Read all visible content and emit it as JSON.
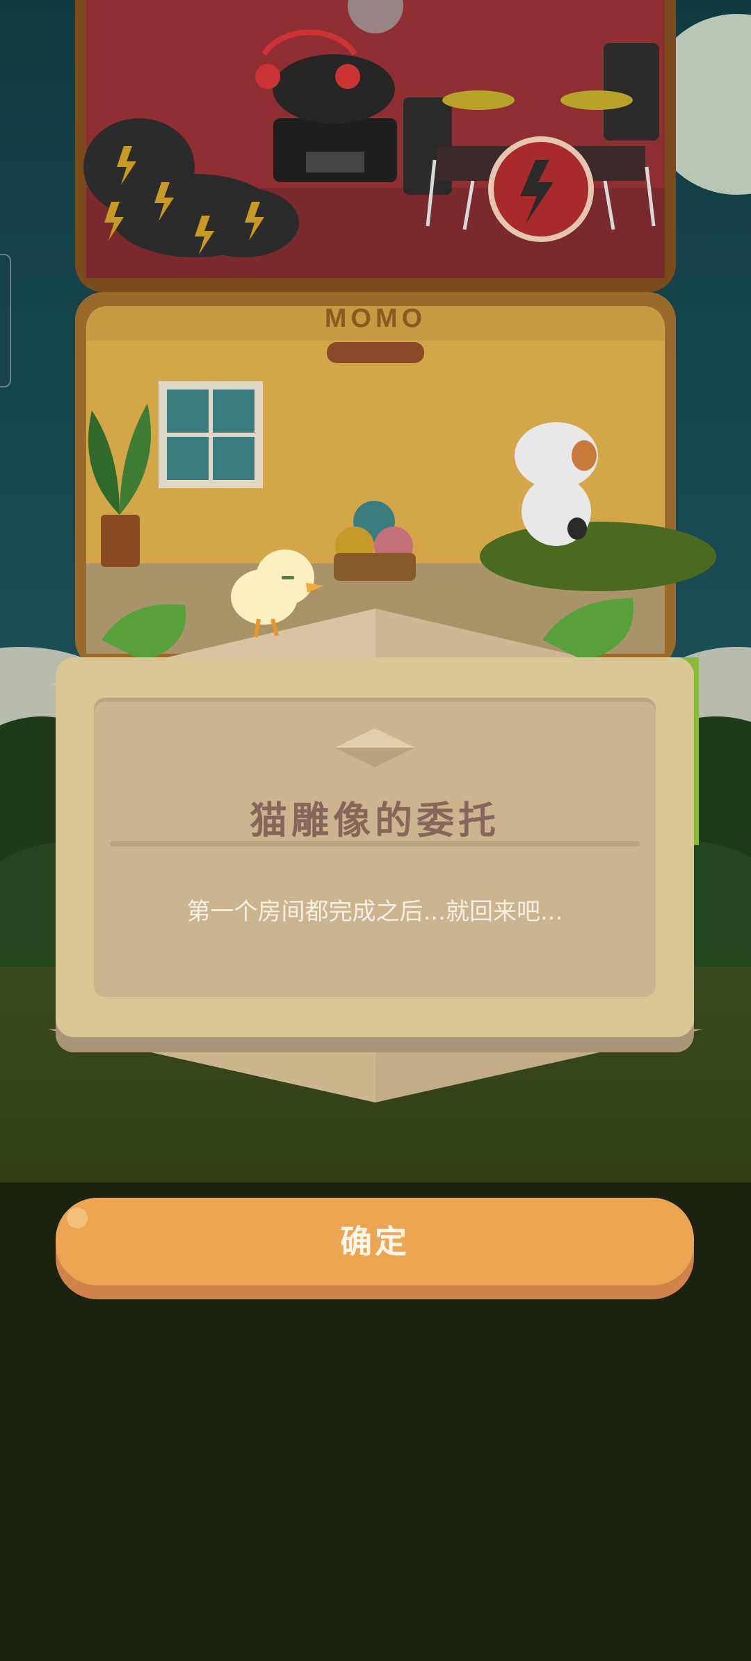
{
  "building": {
    "sign_text": "MOMO"
  },
  "dialog": {
    "title": "猫雕像的委托",
    "message": "第一个房间都完成之后...就回来吧..."
  },
  "confirm_button": {
    "label": "确定"
  },
  "colors": {
    "background": "#1c2210",
    "dialog_outer": "#d9c794",
    "dialog_inner": "#cab58e",
    "title_text": "#86665a",
    "button": "#eba553",
    "button_shadow": "#d0834b"
  }
}
